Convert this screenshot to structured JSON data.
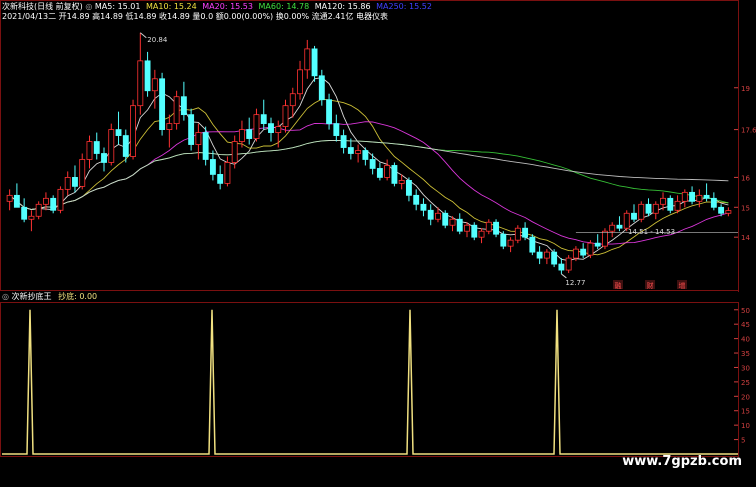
{
  "header": {
    "title_line": "次新科技(日线 前复权)",
    "ma": [
      {
        "label": "MA5: 15.01",
        "color": "#ffffff"
      },
      {
        "label": "MA10: 15.24",
        "color": "#f0e040"
      },
      {
        "label": "MA20: 15.53",
        "color": "#ff40ff"
      },
      {
        "label": "MA60: 14.78",
        "color": "#40e040"
      },
      {
        "label": "MA120: 15.86",
        "color": "#ffffff"
      },
      {
        "label": "MA250: 15.52",
        "color": "#4040ff"
      }
    ],
    "info_line": "2021/04/13二 开14.89 高14.89 低14.89 收14.89 量0.0 额0.00(0.00%) 换0.00% 流通2.41亿 电器仪表"
  },
  "indicator": {
    "title": "次新抄底王",
    "value_label": "抄底: 0.00"
  },
  "watermark": "www.7gpzb.com",
  "markers": [
    "融",
    "财",
    "增"
  ],
  "chart_data": [
    {
      "type": "candlestick",
      "title": "次新科技(日线 前复权)",
      "y_axis_labels": [
        "17.6",
        "16",
        "15",
        "14",
        "19"
      ],
      "price_annotations": [
        "20.84",
        "12.77",
        "14.51",
        "14.53"
      ],
      "ohlc": [
        [
          15.2,
          15.6,
          14.9,
          15.4
        ],
        [
          15.4,
          15.8,
          15.1,
          15.0
        ],
        [
          15.0,
          15.3,
          14.5,
          14.6
        ],
        [
          14.6,
          14.9,
          14.2,
          14.7
        ],
        [
          14.7,
          15.2,
          14.6,
          15.1
        ],
        [
          15.1,
          15.5,
          14.9,
          15.3
        ],
        [
          15.3,
          15.4,
          14.8,
          14.9
        ],
        [
          14.9,
          15.7,
          14.8,
          15.6
        ],
        [
          15.6,
          16.2,
          15.4,
          16.0
        ],
        [
          16.0,
          16.4,
          15.5,
          15.7
        ],
        [
          15.7,
          16.8,
          15.6,
          16.6
        ],
        [
          16.6,
          17.4,
          16.3,
          17.2
        ],
        [
          17.2,
          17.5,
          16.6,
          16.8
        ],
        [
          16.8,
          17.0,
          16.2,
          16.5
        ],
        [
          16.5,
          17.8,
          16.4,
          17.6
        ],
        [
          17.6,
          18.2,
          17.1,
          17.4
        ],
        [
          17.4,
          17.6,
          16.5,
          16.7
        ],
        [
          16.7,
          18.6,
          16.6,
          18.4
        ],
        [
          18.4,
          20.84,
          18.1,
          19.9
        ],
        [
          19.9,
          20.2,
          18.7,
          18.9
        ],
        [
          18.9,
          19.6,
          18.3,
          19.3
        ],
        [
          19.3,
          19.5,
          17.4,
          17.6
        ],
        [
          17.6,
          18.1,
          17.0,
          17.8
        ],
        [
          17.8,
          18.9,
          17.6,
          18.7
        ],
        [
          18.7,
          19.2,
          17.9,
          18.1
        ],
        [
          18.1,
          18.3,
          16.9,
          17.1
        ],
        [
          17.1,
          17.8,
          16.6,
          17.5
        ],
        [
          17.5,
          17.7,
          16.4,
          16.6
        ],
        [
          16.6,
          16.9,
          15.9,
          16.1
        ],
        [
          16.1,
          16.4,
          15.6,
          15.8
        ],
        [
          15.8,
          16.7,
          15.7,
          16.5
        ],
        [
          16.5,
          17.4,
          16.3,
          17.2
        ],
        [
          17.2,
          17.9,
          17.0,
          17.6
        ],
        [
          17.6,
          18.0,
          17.1,
          17.3
        ],
        [
          17.3,
          18.3,
          17.2,
          18.1
        ],
        [
          18.1,
          18.6,
          17.6,
          17.8
        ],
        [
          17.8,
          18.0,
          17.2,
          17.5
        ],
        [
          17.5,
          17.9,
          17.0,
          17.7
        ],
        [
          17.7,
          18.6,
          17.5,
          18.4
        ],
        [
          18.4,
          19.0,
          18.0,
          18.8
        ],
        [
          18.8,
          19.9,
          18.6,
          19.6
        ],
        [
          19.6,
          20.6,
          19.3,
          20.3
        ],
        [
          20.3,
          20.4,
          19.2,
          19.4
        ],
        [
          19.4,
          19.6,
          18.4,
          18.6
        ],
        [
          18.6,
          18.8,
          17.6,
          17.8
        ],
        [
          17.8,
          18.1,
          17.2,
          17.4
        ],
        [
          17.4,
          17.6,
          16.8,
          17.0
        ],
        [
          17.0,
          17.3,
          16.6,
          16.8
        ],
        [
          16.8,
          17.1,
          16.5,
          16.9
        ],
        [
          16.9,
          17.0,
          16.4,
          16.6
        ],
        [
          16.6,
          16.8,
          16.1,
          16.3
        ],
        [
          16.3,
          16.5,
          15.9,
          16.0
        ],
        [
          16.0,
          16.6,
          15.9,
          16.4
        ],
        [
          16.4,
          16.5,
          15.7,
          15.8
        ],
        [
          15.8,
          16.1,
          15.6,
          15.9
        ],
        [
          15.9,
          16.0,
          15.2,
          15.4
        ],
        [
          15.4,
          15.6,
          14.9,
          15.1
        ],
        [
          15.1,
          15.3,
          14.7,
          14.9
        ],
        [
          14.9,
          15.1,
          14.4,
          14.6
        ],
        [
          14.6,
          15.0,
          14.5,
          14.8
        ],
        [
          14.8,
          14.9,
          14.3,
          14.4
        ],
        [
          14.4,
          14.7,
          14.2,
          14.6
        ],
        [
          14.6,
          14.8,
          14.1,
          14.2
        ],
        [
          14.2,
          14.5,
          14.0,
          14.4
        ],
        [
          14.4,
          14.5,
          13.9,
          14.0
        ],
        [
          14.0,
          14.3,
          13.8,
          14.2
        ],
        [
          14.2,
          14.6,
          14.1,
          14.5
        ],
        [
          14.5,
          14.6,
          14.0,
          14.1
        ],
        [
          14.1,
          14.2,
          13.6,
          13.7
        ],
        [
          13.7,
          14.0,
          13.5,
          13.9
        ],
        [
          13.9,
          14.4,
          13.8,
          14.3
        ],
        [
          14.3,
          14.5,
          13.9,
          14.0
        ],
        [
          14.0,
          14.1,
          13.4,
          13.5
        ],
        [
          13.5,
          13.7,
          13.1,
          13.3
        ],
        [
          13.3,
          13.6,
          13.1,
          13.5
        ],
        [
          13.5,
          13.6,
          13.0,
          13.1
        ],
        [
          13.1,
          13.3,
          12.77,
          12.9
        ],
        [
          12.9,
          13.4,
          12.8,
          13.3
        ],
        [
          13.3,
          13.7,
          13.2,
          13.6
        ],
        [
          13.6,
          13.8,
          13.3,
          13.4
        ],
        [
          13.4,
          13.9,
          13.3,
          13.8
        ],
        [
          13.8,
          14.1,
          13.6,
          13.7
        ],
        [
          13.7,
          14.3,
          13.6,
          14.2
        ],
        [
          14.2,
          14.5,
          14.0,
          14.4
        ],
        [
          14.4,
          14.7,
          14.2,
          14.3
        ],
        [
          14.3,
          14.9,
          14.2,
          14.8
        ],
        [
          14.8,
          15.1,
          14.51,
          14.6
        ],
        [
          14.6,
          15.2,
          14.5,
          15.1
        ],
        [
          15.1,
          15.3,
          14.7,
          14.8
        ],
        [
          14.8,
          15.2,
          14.6,
          15.1
        ],
        [
          15.1,
          15.5,
          14.9,
          15.3
        ],
        [
          15.3,
          15.4,
          14.8,
          14.9
        ],
        [
          14.9,
          15.4,
          14.8,
          15.2
        ],
        [
          15.2,
          15.6,
          15.0,
          15.5
        ],
        [
          15.5,
          15.7,
          15.1,
          15.2
        ],
        [
          15.2,
          15.6,
          15.0,
          15.4
        ],
        [
          15.4,
          15.8,
          15.2,
          15.3
        ],
        [
          15.3,
          15.5,
          14.9,
          15.0
        ],
        [
          15.0,
          15.1,
          14.7,
          14.8
        ],
        [
          14.8,
          15.0,
          14.7,
          14.89
        ]
      ],
      "series": [
        {
          "name": "MA5",
          "color": "#ffffff"
        },
        {
          "name": "MA10",
          "color": "#f0e040"
        },
        {
          "name": "MA20",
          "color": "#ff40ff"
        },
        {
          "name": "MA60",
          "color": "#40e040"
        },
        {
          "name": "MA120",
          "color": "#dddddd"
        }
      ]
    },
    {
      "type": "line",
      "title": "次新抄底王",
      "series": [
        {
          "name": "抄底",
          "color": "#f0e080"
        }
      ],
      "spike_positions": [
        4,
        30,
        59,
        80
      ],
      "spike_height": 50,
      "y_axis_labels": [
        "50",
        "45",
        "40",
        "35",
        "30",
        "25",
        "20",
        "15",
        "10",
        "5"
      ],
      "ylim": [
        0,
        52
      ]
    }
  ]
}
